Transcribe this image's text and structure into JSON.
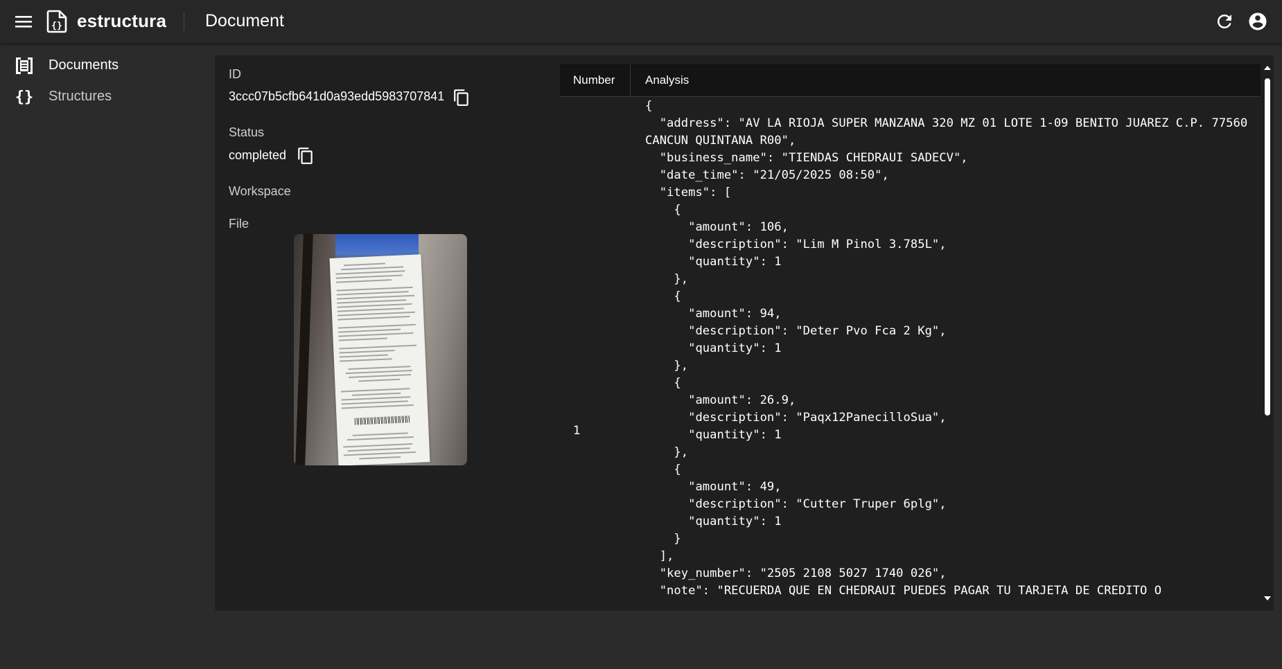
{
  "appbar": {
    "brand": "estructura",
    "page_title": "Document"
  },
  "sidebar": {
    "items": [
      {
        "label": "Documents",
        "icon": "document-list-icon",
        "active": true
      },
      {
        "label": "Structures",
        "icon": "curly-braces-icon",
        "active": false
      }
    ]
  },
  "document": {
    "id_label": "ID",
    "id_value": "3ccc07b5cfb641d0a93edd5983707841",
    "status_label": "Status",
    "status_value": "completed",
    "workspace_label": "Workspace",
    "file_label": "File"
  },
  "table": {
    "headers": {
      "number": "Number",
      "analysis": "Analysis"
    },
    "rows": [
      {
        "number": "1",
        "analysis": "{\n  \"address\": \"AV LA RIOJA SUPER MANZANA 320 MZ 01 LOTE 1-09 BENITO JUAREZ C.P. 77560 CANCUN QUINTANA R00\",\n  \"business_name\": \"TIENDAS CHEDRAUI SADECV\",\n  \"date_time\": \"21/05/2025 08:50\",\n  \"items\": [\n    {\n      \"amount\": 106,\n      \"description\": \"Lim M Pinol 3.785L\",\n      \"quantity\": 1\n    },\n    {\n      \"amount\": 94,\n      \"description\": \"Deter Pvo Fca 2 Kg\",\n      \"quantity\": 1\n    },\n    {\n      \"amount\": 26.9,\n      \"description\": \"Paqx12PanecilloSua\",\n      \"quantity\": 1\n    },\n    {\n      \"amount\": 49,\n      \"description\": \"Cutter Truper 6plg\",\n      \"quantity\": 1\n    }\n  ],\n  \"key_number\": \"2505 2108 5027 1740 026\",\n  \"note\": \"RECUERDA QUE EN CHEDRAUI PUEDES PAGAR TU TARJETA DE CREDITO O"
      }
    ]
  },
  "icons": {
    "menu": "menu-icon",
    "logo": "document-braces-logo-icon",
    "refresh": "refresh-icon",
    "account": "account-circle-icon",
    "copy": "copy-icon",
    "scroll_up": "arrow-up-icon",
    "scroll_down": "arrow-down-icon"
  },
  "colors": {
    "appbar": "#272727",
    "background": "#2b2b2b",
    "card": "#1f1f1f",
    "table_header": "#141414",
    "text": "#ffffff"
  }
}
